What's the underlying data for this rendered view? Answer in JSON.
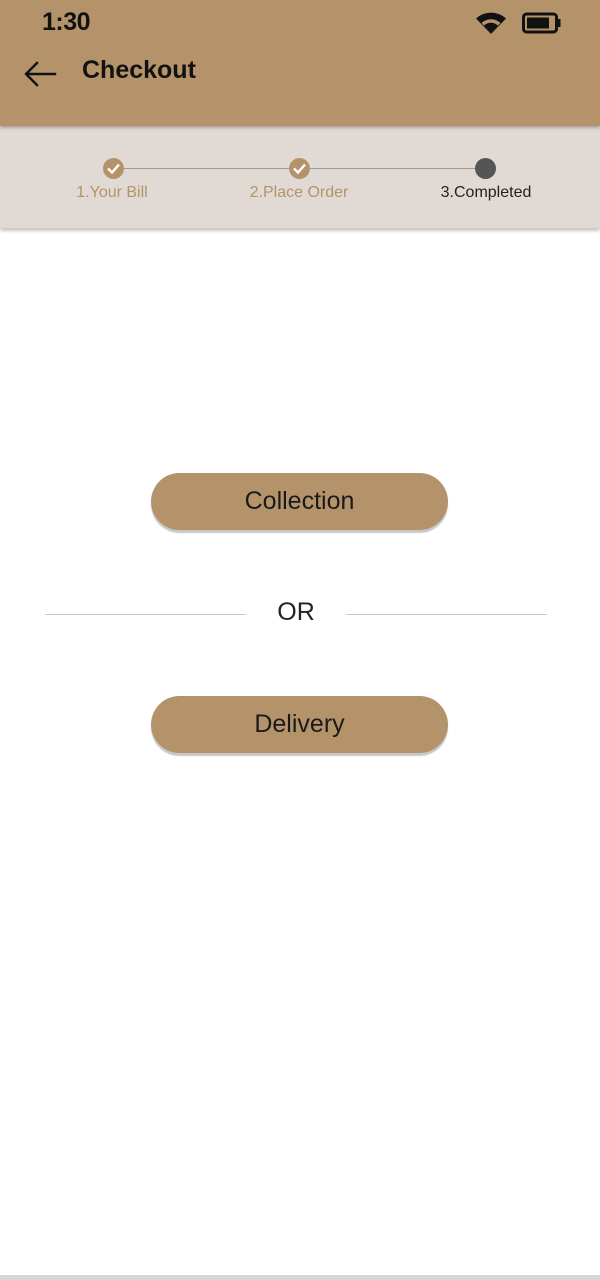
{
  "status_bar": {
    "time": "1:30",
    "wifi_icon": "wifi-icon",
    "battery_icon": "battery-icon"
  },
  "header": {
    "back_icon": "arrow-left-icon",
    "title": "Checkout"
  },
  "stepper": {
    "steps": [
      {
        "label": "1.Your Bill",
        "state": "done"
      },
      {
        "label": "2.Place Order",
        "state": "done"
      },
      {
        "label": "3.Completed",
        "state": "current"
      }
    ]
  },
  "options": {
    "collection_label": "Collection",
    "or_label": "OR",
    "delivery_label": "Delivery"
  },
  "colors": {
    "primary": "#b5936a",
    "stepper_background": "#e1d9d3",
    "current_step": "#555555",
    "text": "#111111"
  }
}
